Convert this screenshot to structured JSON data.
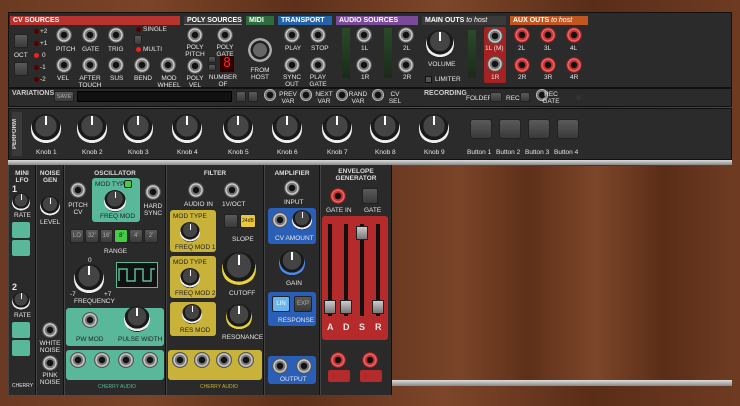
{
  "top": {
    "cv_sources": {
      "title": "CV SOURCES",
      "pitch": "PITCH",
      "gate": "GATE",
      "trig": "TRIG",
      "vel": "VEL",
      "after_touch": "AFTER TOUCH",
      "sus": "SUS",
      "bend": "BEND",
      "mod_wheel": "MOD WHEEL",
      "single": "SINGLE",
      "multi": "MULTI",
      "oct": "OCT",
      "oct_values": [
        "+2",
        "+1",
        "0",
        "-1",
        "-2"
      ]
    },
    "poly_sources": {
      "title": "POLY SOURCES",
      "poly_pitch": "POLY PITCH",
      "poly_gate": "POLY GATE",
      "poly_vel": "POLY VEL",
      "num_voices": "NUMBER OF VOICES",
      "voices_value": "8"
    },
    "midi": {
      "title": "MIDI",
      "from_host": "FROM HOST"
    },
    "transport": {
      "title": "TRANSPORT",
      "play": "PLAY",
      "stop": "STOP",
      "sync_out": "SYNC OUT",
      "play_gate": "PLAY GATE"
    },
    "audio_sources": {
      "title": "AUDIO SOURCES",
      "l1": "1L",
      "l2": "2L",
      "r1": "1R",
      "r2": "2R"
    },
    "main_outs": {
      "title": "MAIN OUTS",
      "title_suffix": "to host",
      "volume": "VOLUME",
      "limiter": "LIMITER",
      "l1m": "1L (M)",
      "r1": "1R"
    },
    "aux_outs": {
      "title": "AUX OUTS",
      "title_suffix": "to host",
      "labels": [
        "2L",
        "3L",
        "4L",
        "2R",
        "3R",
        "4R"
      ]
    },
    "variations": {
      "title": "VARIATIONS",
      "save": "SAVE",
      "prev": "PREV VAR",
      "next": "NEXT VAR",
      "rand": "RAND VAR",
      "cv_sel": "CV SEL"
    },
    "recording": {
      "title": "RECORDING",
      "folder": "FOLDER",
      "rec": "REC",
      "rec_gate": "REC GATE"
    }
  },
  "perform": {
    "title": "PERFORM",
    "knobs": [
      "Knob 1",
      "Knob 2",
      "Knob 3",
      "Knob 4",
      "Knob 5",
      "Knob 6",
      "Knob 7",
      "Knob 8",
      "Knob 9"
    ],
    "buttons": [
      "Button 1",
      "Button 2",
      "Button 3",
      "Button 4"
    ]
  },
  "modules": {
    "mini_lfo": {
      "title": "MINI LFO",
      "rate": "RATE",
      "n1": "1",
      "n2": "2"
    },
    "noise_gen": {
      "title": "NOISE GEN",
      "level": "LEVEL",
      "white": "WHITE NOISE",
      "pink": "PINK NOISE"
    },
    "oscillator": {
      "title": "OSCILLATOR",
      "pitch_cv": "PITCH CV",
      "mod_type": "MOD TYPE",
      "freq_mod": "FREQ MOD",
      "hard_sync": "HARD SYNC",
      "range": "RANGE",
      "range_values": [
        "LO",
        "32'",
        "16'",
        "8'",
        "4'",
        "2'"
      ],
      "frequency": "FREQUENCY",
      "freq_min": "-7",
      "freq_max": "+7",
      "freq_zero": "0",
      "pw_mod": "PW MOD",
      "pulse_width": "PULSE WIDTH",
      "brand": "CHERRY AUDIO"
    },
    "filter": {
      "title": "FILTER",
      "audio_in": "AUDIO IN",
      "v_oct": "1V/OCT",
      "mod_type": "MOD TYPE",
      "freq_mod1": "FREQ MOD 1",
      "freq_mod2": "FREQ MOD 2",
      "res_mod": "RES MOD",
      "slope": "SLOPE",
      "s24": "24dB",
      "cutoff": "CUTOFF",
      "resonance": "RESONANCE",
      "brand": "CHERRY AUDIO"
    },
    "amplifier": {
      "title": "AMPLIFIER",
      "input": "INPUT",
      "cv_amount": "CV AMOUNT",
      "gain": "GAIN",
      "response": "RESPONSE",
      "lin": "LIN",
      "exp": "EXP",
      "output": "OUTPUT"
    },
    "envelope": {
      "title": "ENVELOPE GENERATOR",
      "gate_in": "GATE IN",
      "gate": "GATE",
      "adsr": [
        "A",
        "D",
        "S",
        "R"
      ]
    },
    "brand_small": "CHERRY"
  },
  "colors": {
    "cv": "#b8322e",
    "poly": "#3a3a3a",
    "midi": "#2e6b3e",
    "transport": "#2563a8",
    "audio": "#7a4a9a",
    "main": "#3a3a3a",
    "aux": "#c2561f",
    "osc_green": "#5ab89a",
    "filter_yellow": "#c9b23a",
    "amp_blue": "#2a5fb8",
    "env_red": "#b52a2a"
  }
}
